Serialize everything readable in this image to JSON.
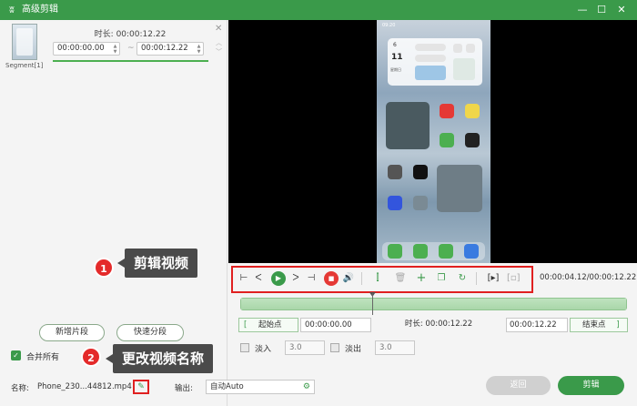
{
  "window": {
    "title": "高级剪辑",
    "logo_glyph": "ʬ",
    "minimize_glyph": "—",
    "maximize_glyph": "☐",
    "close_glyph": "✕"
  },
  "segment": {
    "label": "Segment[1]",
    "duration_label": "时长: 00:00:12.22",
    "start": "00:00:00.00",
    "end": "00:00:12.22",
    "dash": "~",
    "close_glyph": "✕",
    "up_glyph": "︿",
    "down_glyph": "﹀"
  },
  "left_panel": {
    "add_segment_label": "新增片段",
    "quick_split_label": "快速分段",
    "merge_all_label": "合并所有",
    "merge_all_checked": true
  },
  "phone": {
    "status_time": "09:20",
    "clock_day": "6",
    "clock_date": "11",
    "clock_week": "星期日"
  },
  "controls": {
    "time_display": "00:00:04.12/00:00:12.22",
    "icons": [
      "mark-in-icon",
      "prev-frame-icon",
      "play-icon",
      "next-frame-icon",
      "mark-out-icon",
      "stop-icon",
      "volume-icon",
      "split-icon",
      "delete-icon",
      "add-icon",
      "copy-icon",
      "reset-icon",
      "crop-icon",
      "fullscreen-icon"
    ]
  },
  "timeline": {
    "playhead_fraction": 0.34
  },
  "edit_row": {
    "start_bracket": "[",
    "start_label": "起始点",
    "start_value": "00:00:00.00",
    "duration_label": "时长: 00:00:12.22",
    "end_value": "00:00:12.22",
    "end_label": "结束点",
    "end_bracket": "]"
  },
  "fade": {
    "fade_in_label": "淡入",
    "fade_in_value": "3.0",
    "fade_out_label": "淡出",
    "fade_out_value": "3.0"
  },
  "bottom": {
    "name_label": "名称:",
    "name_value": "Phone_230...44812.mp4",
    "output_label": "输出:",
    "output_value": "自动Auto",
    "back_label": "返回",
    "confirm_label": "剪辑"
  },
  "annotations": {
    "badge_1": "1",
    "callout_1": "剪辑视频",
    "badge_2": "2",
    "callout_2": "更改视频名称"
  },
  "colors": {
    "accent": "#3a9a4a",
    "highlight": "#e02020",
    "stop": "#e53935"
  }
}
